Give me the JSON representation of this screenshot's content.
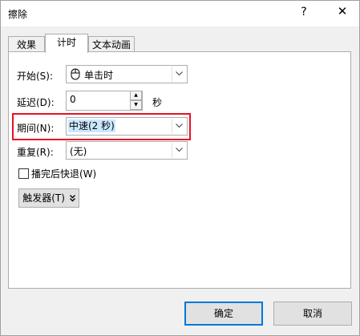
{
  "window": {
    "title": "擦除",
    "help_glyph": "?",
    "close_glyph": "✕"
  },
  "tabs": [
    {
      "label": "效果",
      "active": false
    },
    {
      "label": "计时",
      "active": true
    },
    {
      "label": "文本动画",
      "active": false
    }
  ],
  "timing": {
    "start": {
      "label": "开始(S):",
      "value": "单击时",
      "icon": "mouse-icon"
    },
    "delay": {
      "label": "延迟(D):",
      "value": "0",
      "unit": "秒"
    },
    "duration": {
      "label": "期间(N):",
      "value": "中速(2 秒)",
      "highlight_color": "#e81123",
      "selection_color": "#cce8ff"
    },
    "repeat": {
      "label": "重复(R):",
      "value": "(无)"
    },
    "rewind": {
      "label": "播完后快退(W)",
      "checked": false
    },
    "trigger": {
      "label": "触发器(T)"
    }
  },
  "buttons": {
    "ok": "确定",
    "cancel": "取消"
  }
}
